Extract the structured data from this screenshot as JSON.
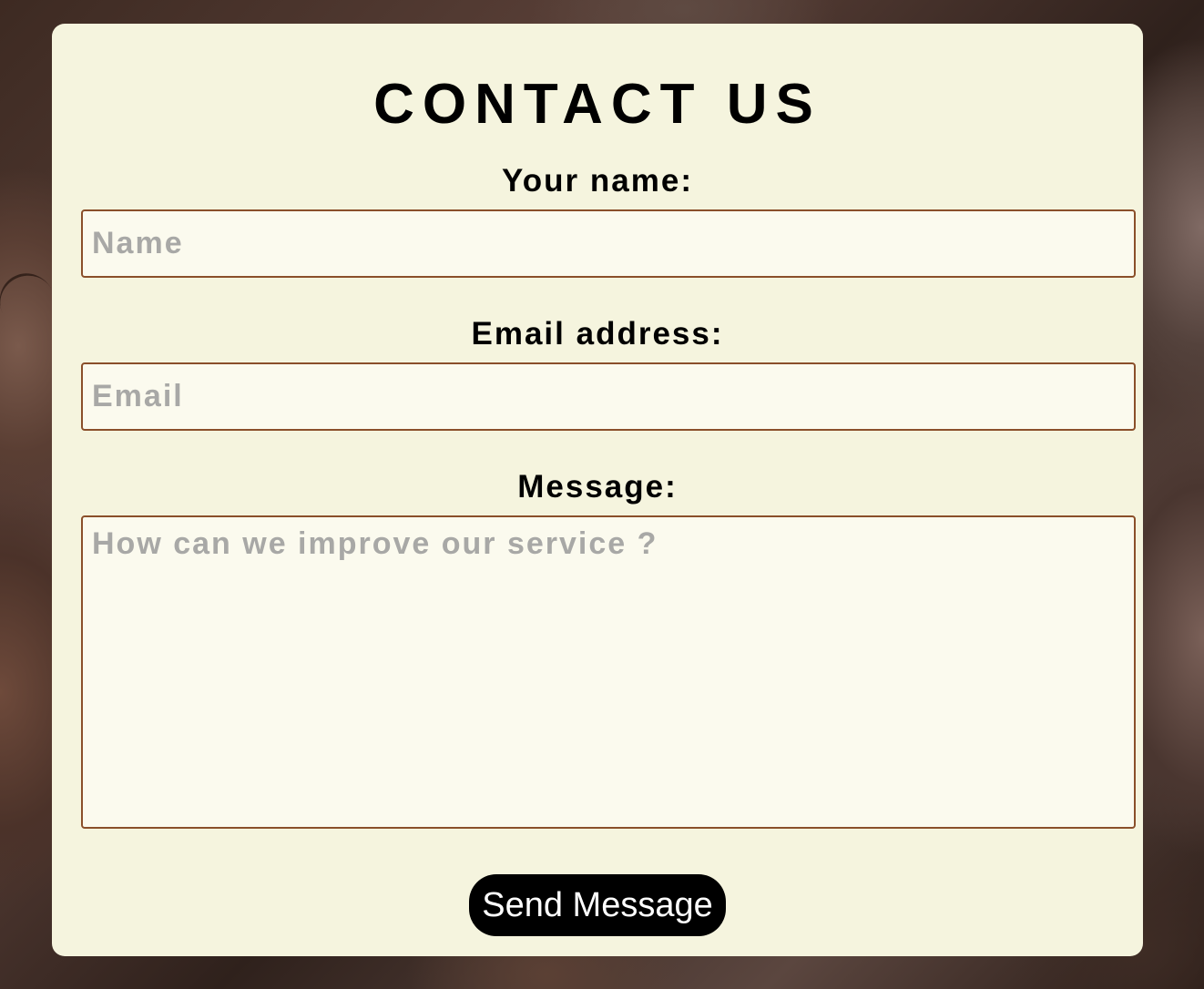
{
  "contact": {
    "title": "CONTACT US",
    "name": {
      "label": "Your name:",
      "placeholder": "Name",
      "value": ""
    },
    "email": {
      "label": "Email address:",
      "placeholder": "Email",
      "value": ""
    },
    "message": {
      "label": "Message:",
      "placeholder": "How can we improve our service ?",
      "value": ""
    },
    "submit_label": "Send Message"
  },
  "colors": {
    "card_background": "#f5f4de",
    "field_background": "#fbfaee",
    "field_border": "#8a4f2a",
    "button_background": "#000000",
    "button_text": "#ffffff",
    "placeholder_text": "#a8a8a6"
  }
}
